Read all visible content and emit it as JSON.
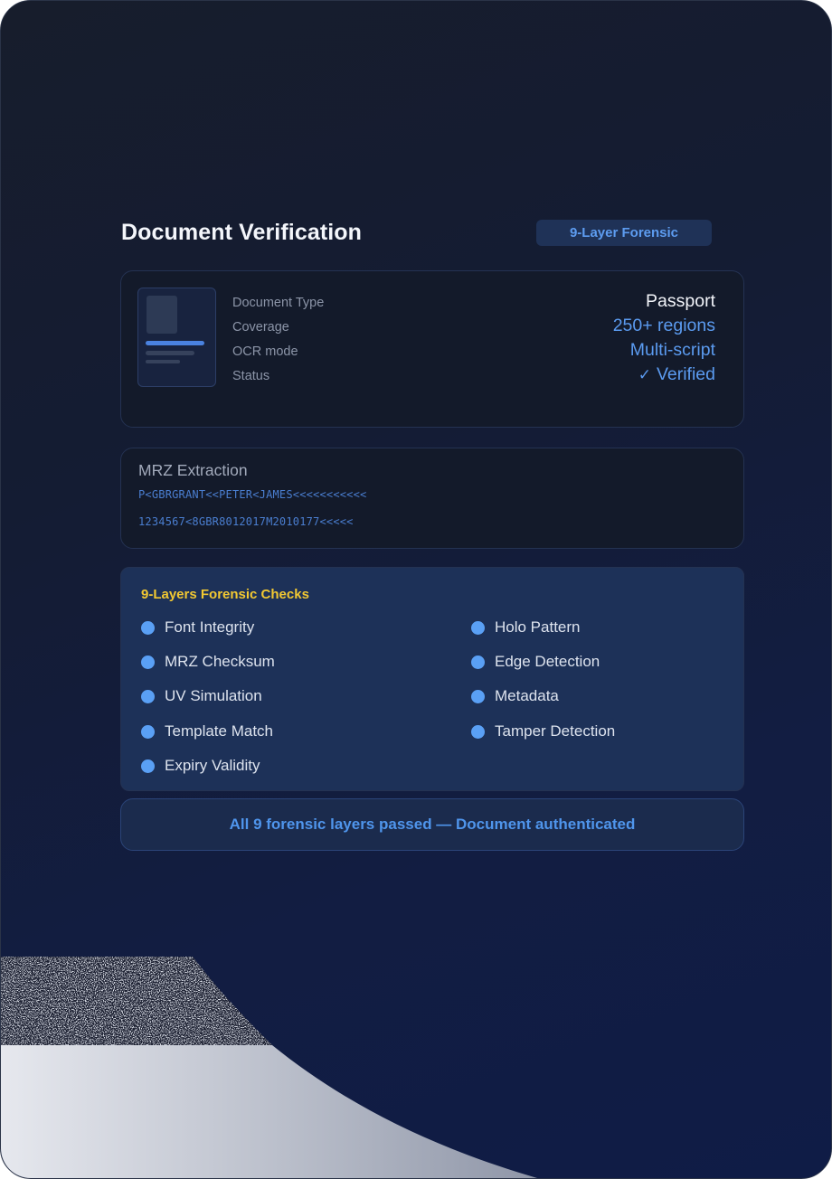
{
  "header": {
    "title": "Document Verification",
    "badge": "9-Layer Forensic"
  },
  "document": {
    "labels": [
      "Document Type",
      "Coverage",
      "OCR mode",
      "Status"
    ],
    "values": {
      "type": "Passport",
      "coverage": "250+ regions",
      "ocr_mode": "Multi-script",
      "status": "Verified"
    },
    "status_icon": "check-icon"
  },
  "mrz": {
    "title": "MRZ Extraction",
    "line1": "P<GBRGRANT<<PETER<JAMES<<<<<<<<<<<",
    "line2": "1234567<8GBR8012017M2010177<<<<<"
  },
  "checks": {
    "title": "9-Layers Forensic Checks",
    "left": [
      "Font Integrity",
      "MRZ Checksum",
      "UV Simulation",
      "Template Match",
      "Expiry Validity"
    ],
    "right": [
      "Holo Pattern",
      "Edge Detection",
      "Metadata",
      "Tamper Detection"
    ]
  },
  "result": {
    "text": "All 9 forensic layers passed — Document authenticated"
  },
  "colors": {
    "accent": "#5b9bf0",
    "checks_title": "#f2c832",
    "background": "#121d42"
  }
}
